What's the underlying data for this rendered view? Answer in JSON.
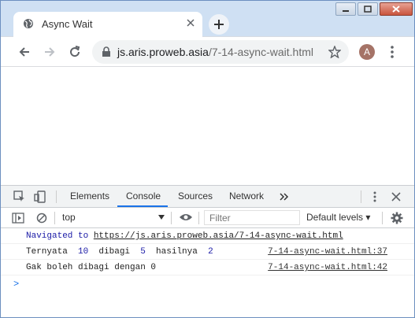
{
  "browser": {
    "tab_title": "Async Wait",
    "url_host": "js.aris.proweb.asia",
    "url_path": "/7-14-async-wait.html",
    "avatar_letter": "A"
  },
  "devtools": {
    "tabs": [
      "Elements",
      "Console",
      "Sources",
      "Network"
    ],
    "active_tab": "Console",
    "context": "top",
    "filter_placeholder": "Filter",
    "levels_label": "Default levels ▾",
    "console": {
      "navigated_prefix": "Navigated to ",
      "navigated_url": "https://js.aris.proweb.asia/7-14-async-wait.html",
      "line1": {
        "w1": "Ternyata",
        "n1": "10",
        "w2": "dibagi",
        "n2": "5",
        "w3": "hasilnya",
        "n3": "2",
        "source": "7-14-async-wait.html:37"
      },
      "line2": {
        "text": "Gak boleh dibagi dengan 0",
        "source": "7-14-async-wait.html:42"
      },
      "prompt": ">"
    }
  },
  "colors": {
    "tabstrip": "#cfe0f3",
    "accent": "#1a73e8",
    "console_number": "#1a1aa6"
  }
}
